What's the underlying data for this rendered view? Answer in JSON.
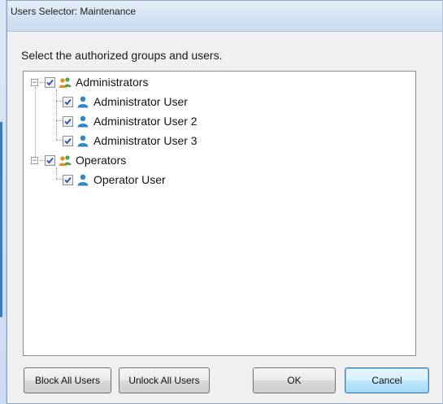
{
  "window": {
    "title": "Users Selector: Maintenance"
  },
  "instruction": "Select the authorized groups and users.",
  "tree": {
    "groups": [
      {
        "label": "Administrators",
        "expander": "−",
        "checked": true,
        "icon": "group-icon",
        "users": [
          {
            "label": "Administrator User",
            "checked": true,
            "icon": "user-icon"
          },
          {
            "label": "Administrator User 2",
            "checked": true,
            "icon": "user-icon"
          },
          {
            "label": "Administrator User 3",
            "checked": true,
            "icon": "user-icon"
          }
        ]
      },
      {
        "label": "Operators",
        "expander": "−",
        "checked": true,
        "icon": "group-icon",
        "users": [
          {
            "label": "Operator User",
            "checked": true,
            "icon": "user-icon"
          }
        ]
      }
    ]
  },
  "buttons": {
    "block_all": "Block All Users",
    "unlock_all": "Unlock All Users",
    "ok": "OK",
    "cancel": "Cancel"
  },
  "colors": {
    "title_bar": "#d4e2f3",
    "dialog_bg": "#f0f0f0",
    "default_button": "#bee6fd",
    "user_icon": "#2f86c9",
    "group_icon_green": "#4caa3c",
    "group_icon_orange": "#e28a1e"
  }
}
